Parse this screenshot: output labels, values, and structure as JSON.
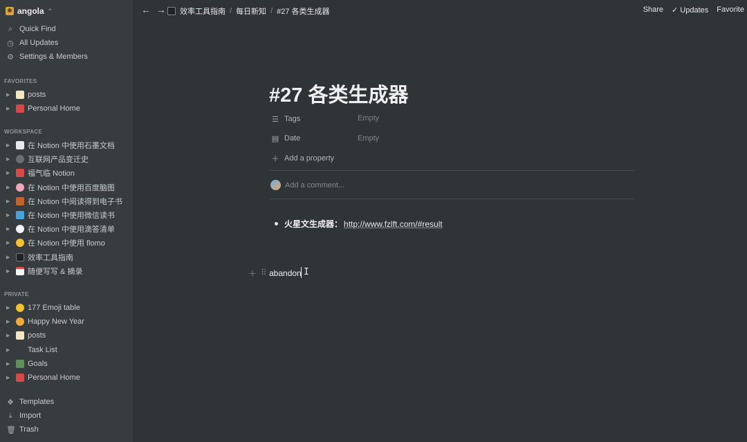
{
  "workspace": {
    "name": "angola"
  },
  "sidebar": {
    "top_links": [
      {
        "label": "Quick Find",
        "icon": "search-icon"
      },
      {
        "label": "All Updates",
        "icon": "clock-icon"
      },
      {
        "label": "Settings & Members",
        "icon": "gear-icon"
      }
    ],
    "favorites_label": "FAVORITES",
    "favorites": [
      {
        "label": "posts",
        "icon": "memo-icon"
      },
      {
        "label": "Personal Home",
        "icon": "red-book-icon"
      }
    ],
    "workspace_label": "WORKSPACE",
    "workspace_pages": [
      {
        "label": "在 Notion 中使用石墨文档",
        "icon": "document-icon"
      },
      {
        "label": "互联网产品变迁史",
        "icon": "gear-dot-icon"
      },
      {
        "label": "福气临 Notion",
        "icon": "red-tag-icon"
      },
      {
        "label": "在 Notion 中使用百度脑图",
        "icon": "brain-icon"
      },
      {
        "label": "在 Notion 中阅读得到电子书",
        "icon": "owl-icon"
      },
      {
        "label": "在 Notion 中使用微信读书",
        "icon": "blue-book-icon"
      },
      {
        "label": "在 Notion 中使用滴答清单",
        "icon": "check-circle-icon"
      },
      {
        "label": "在 Notion 中使用 flomo",
        "icon": "yellow-circle-icon"
      },
      {
        "label": "效率工具指南",
        "icon": "dark-page-icon"
      },
      {
        "label": "随便写写 & 摘录",
        "icon": "calendar-icon"
      }
    ],
    "private_label": "PRIVATE",
    "private_pages": [
      {
        "label": "177 Emoji table",
        "icon": "smile-icon"
      },
      {
        "label": "Happy New Year",
        "icon": "sun-icon"
      },
      {
        "label": "posts",
        "icon": "memo-icon"
      },
      {
        "label": "Task List",
        "icon": "blank-icon"
      },
      {
        "label": "Goals",
        "icon": "tree-icon"
      },
      {
        "label": "Personal Home",
        "icon": "red-book-icon"
      }
    ],
    "bottom_links": [
      {
        "label": "Templates",
        "icon": "templates-icon"
      },
      {
        "label": "Import",
        "icon": "import-icon"
      },
      {
        "label": "Trash",
        "icon": "trash-icon"
      }
    ]
  },
  "topbar": {
    "breadcrumb": [
      "效率工具指南",
      "每日新知",
      "#27 各类生成器"
    ],
    "share_label": "Share",
    "updates_label": "Updates",
    "favorite_label": "Favorite"
  },
  "page": {
    "title": "#27 各类生成器",
    "properties": [
      {
        "name": "Tags",
        "value": "Empty",
        "icon": "list-icon"
      },
      {
        "name": "Date",
        "value": "Empty",
        "icon": "calendar-icon"
      }
    ],
    "add_property": "Add a property",
    "add_comment": "Add a comment...",
    "bullet_bold": "火星文生成器：",
    "bullet_link": "http://www.fzlft.com/#result",
    "editing_text": "abandon"
  }
}
